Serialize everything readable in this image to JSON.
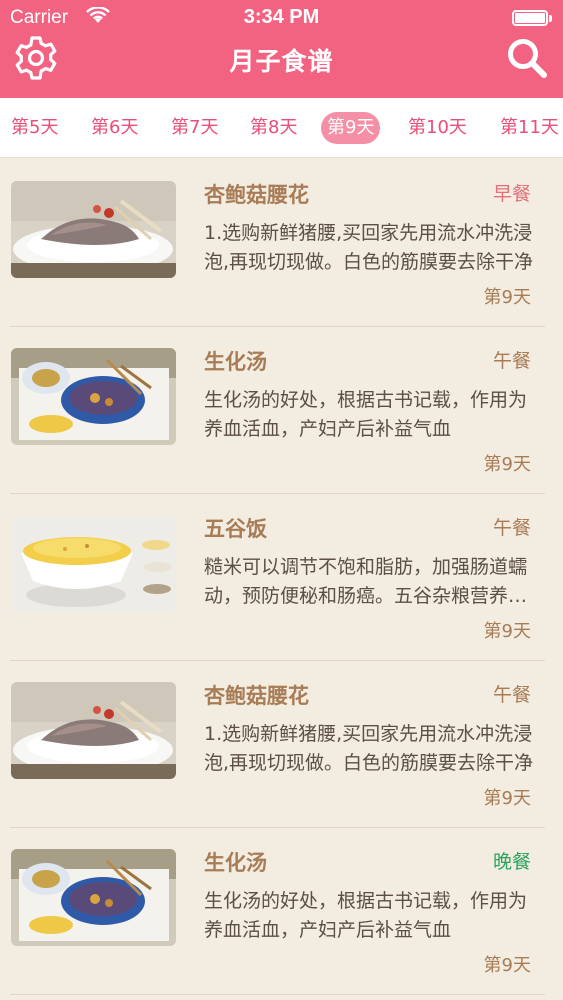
{
  "status": {
    "carrier": "Carrier",
    "time": "3:34 PM"
  },
  "nav": {
    "title": "月子食谱",
    "settings_icon": "gear-icon",
    "search_icon": "search-icon"
  },
  "tabs": [
    {
      "label": "第5天",
      "active": false
    },
    {
      "label": "第6天",
      "active": false
    },
    {
      "label": "第7天",
      "active": false
    },
    {
      "label": "第8天",
      "active": false
    },
    {
      "label": "第9天",
      "active": true
    },
    {
      "label": "第10天",
      "active": false
    },
    {
      "label": "第11天",
      "active": false
    }
  ],
  "recipes": [
    {
      "title": "杏鲍菇腰花",
      "meal": "早餐",
      "desc": "1.选购新鲜猪腰,买回家先用流水冲洗浸泡,再现切现做。白色的筋膜要去除干净",
      "day": "第9天",
      "image": "kidney-dish"
    },
    {
      "title": "生化汤",
      "meal": "午餐",
      "desc": " 生化汤的好处，根据古书记载，作用为养血活血，产妇产后补益气血",
      "day": "第9天",
      "image": "herbal-soup"
    },
    {
      "title": "五谷饭",
      "meal": "午餐",
      "desc": "糙米可以调节不饱和脂肪，加强肠道蠕动，预防便秘和肠癌。五谷杂粮营养丰富",
      "day": "第9天",
      "image": "grain-rice"
    },
    {
      "title": "杏鲍菇腰花",
      "meal": "午餐",
      "desc": "1.选购新鲜猪腰,买回家先用流水冲洗浸泡,再现切现做。白色的筋膜要去除干净",
      "day": "第9天",
      "image": "kidney-dish"
    },
    {
      "title": "生化汤",
      "meal": "晚餐",
      "desc": " 生化汤的好处，根据古书记载，作用为养血活血，产妇产后补益气血",
      "day": "第9天",
      "image": "herbal-soup"
    }
  ],
  "colors": {
    "brand": "#f26382",
    "accent_text": "#a77c56",
    "breakfast": "#e3707a",
    "dinner": "#2aa35f",
    "background": "#f3ece0"
  }
}
